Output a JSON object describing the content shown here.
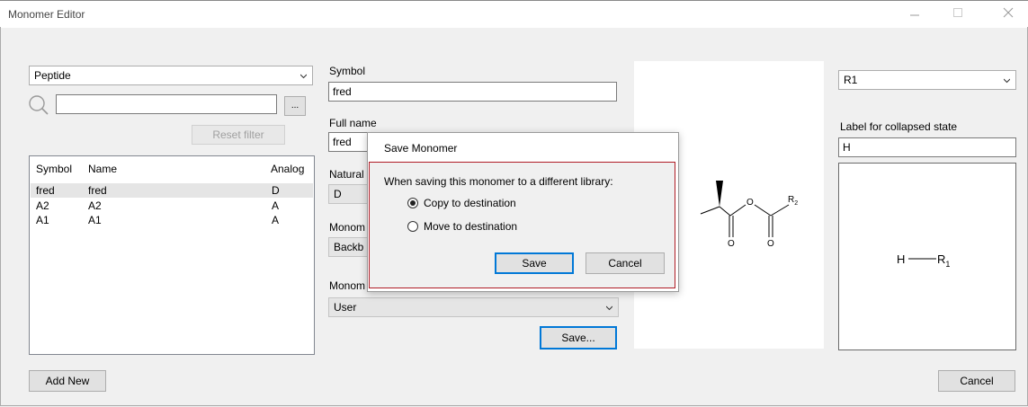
{
  "window": {
    "title": "Monomer Editor",
    "minimize_icon": "minimize-icon",
    "maximize_icon": "maximize-icon",
    "close_icon": "close-icon"
  },
  "left": {
    "polymer_type": "Peptide",
    "search_value": "",
    "browse_label": "...",
    "reset_filter_label": "Reset filter",
    "table": {
      "headers": [
        "Symbol",
        "Name",
        "Analog"
      ],
      "rows": [
        {
          "symbol": "fred",
          "name": "fred",
          "analog": "D",
          "selected": true
        },
        {
          "symbol": "A2",
          "name": "A2",
          "analog": "A",
          "selected": false
        },
        {
          "symbol": "A1",
          "name": "A1",
          "analog": "A",
          "selected": false
        }
      ]
    },
    "add_new_label": "Add New"
  },
  "form": {
    "symbol_label": "Symbol",
    "symbol_value": "fred",
    "fullname_label": "Full name",
    "fullname_value": "fred",
    "natural_label": "Natural",
    "natural_value": "D",
    "monomer_type_label": "Monom",
    "monomer_type_value": "Backb",
    "monomer_lib_label": "Monom",
    "monomer_lib_value": "User",
    "save_label": "Save..."
  },
  "structure": {
    "r2_label": "R",
    "r2_sub": "2",
    "o_label": "O"
  },
  "right": {
    "rgroup_value": "R1",
    "collapsed_label": "Label for collapsed state",
    "collapsed_value": "H",
    "preview_h": "H",
    "preview_r": "R",
    "preview_r_sub": "1",
    "cancel_label": "Cancel"
  },
  "dialog": {
    "title": "Save Monomer",
    "prompt": "When saving this monomer to a different library:",
    "option_copy": "Copy to destination",
    "option_move": "Move to destination",
    "selected_option": "copy",
    "save_label": "Save",
    "cancel_label": "Cancel",
    "accent_color": "#b01c26"
  }
}
